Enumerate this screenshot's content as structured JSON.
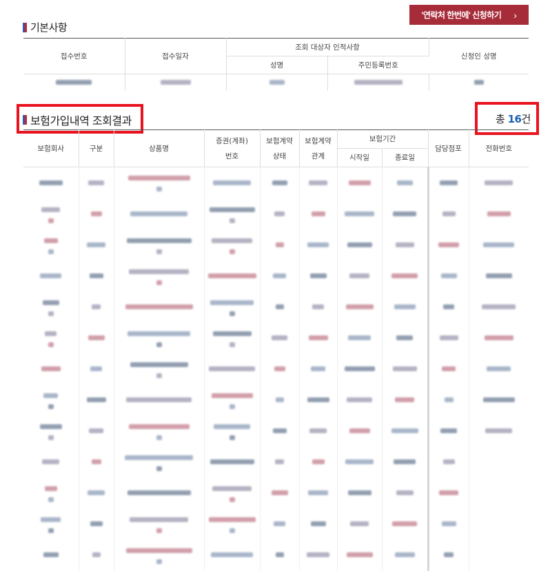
{
  "actions": {
    "apply_label": "'연락처 한번에' 신청하기",
    "chevron": "›"
  },
  "basic_section": {
    "title": "기본사항",
    "headers": {
      "receipt_no": "접수번호",
      "receipt_date": "접수일자",
      "target_group": "조회 대상자 인적사항",
      "name": "성명",
      "resident_no": "주민등록번호",
      "applicant": "신청인 성명"
    }
  },
  "result_section": {
    "title": "보험가입내역 조회결과",
    "total_label": "총",
    "total_count": "16",
    "total_unit": "건",
    "headers": {
      "company": "보험회사",
      "category": "구분",
      "product": "상품명",
      "policy_no_line1": "증권(계좌)",
      "policy_no_line2": "번호",
      "status_line1": "보험계약",
      "status_line2": "상태",
      "relation_line1": "보험계약",
      "relation_line2": "관계",
      "period": "보험기간",
      "start": "시작일",
      "end": "종료일",
      "branch": "담당점포",
      "phone": "전화번호"
    }
  },
  "icons": {
    "title_mark": "title-flag-icon",
    "chevron": "chevron-right-icon"
  },
  "colors": {
    "accent": "#a72c3a",
    "highlight": "#e8131f",
    "count": "#1a5fb4"
  }
}
